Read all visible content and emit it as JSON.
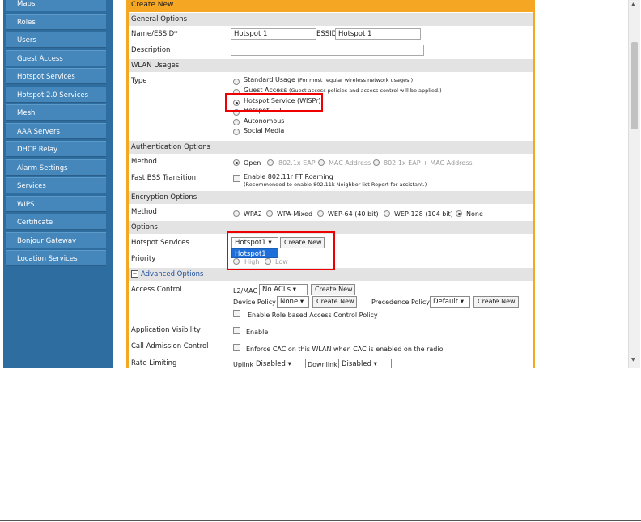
{
  "sidebar": {
    "items": [
      {
        "label": "Maps"
      },
      {
        "label": "Roles"
      },
      {
        "label": "Users"
      },
      {
        "label": "Guest Access"
      },
      {
        "label": "Hotspot Services"
      },
      {
        "label": "Hotspot 2.0 Services"
      },
      {
        "label": "Mesh"
      },
      {
        "label": "AAA Servers"
      },
      {
        "label": "DHCP Relay"
      },
      {
        "label": "Alarm Settings"
      },
      {
        "label": "Services"
      },
      {
        "label": "WIPS"
      },
      {
        "label": "Certificate"
      },
      {
        "label": "Bonjour Gateway"
      },
      {
        "label": "Location Services"
      }
    ]
  },
  "form": {
    "title": "Create New",
    "sections": {
      "general": "General Options",
      "wlan": "WLAN Usages",
      "auth": "Authentication Options",
      "encryption": "Encryption Options",
      "options": "Options",
      "advanced": "Advanced Options"
    },
    "name_label": "Name/ESSID*",
    "name_value": "Hotspot 1",
    "essid_label": "ESSID",
    "essid_value": "Hotspot 1",
    "description_label": "Description",
    "description_value": "",
    "type_label": "Type",
    "type_options": [
      {
        "label": "Standard Usage",
        "note": "(For most regular wireless network usages.)"
      },
      {
        "label": "Guest Access",
        "note": "(Guest access policies and access control will be applied.)"
      },
      {
        "label": "Hotspot Service (WISPr)",
        "note": ""
      },
      {
        "label": "Hotspot 2.0",
        "note": ""
      },
      {
        "label": "Autonomous",
        "note": ""
      },
      {
        "label": "Social Media",
        "note": ""
      }
    ],
    "auth_method_label": "Method",
    "auth_methods": [
      "Open",
      "802.1x EAP",
      "MAC Address",
      "802.1x EAP + MAC Address"
    ],
    "fast_bss_label": "Fast BSS Transition",
    "fast_bss_text": "Enable 802.11r FT Roaming",
    "fast_bss_note": "(Recommended to enable 802.11k Neighbor-list Report for assistant.)",
    "enc_method_label": "Method",
    "enc_methods": [
      "WPA2",
      "WPA-Mixed",
      "WEP-64 (40 bit)",
      "WEP-128 (104 bit)",
      "None"
    ],
    "hotspot_services_label": "Hotspot Services",
    "hotspot_select_value": "Hotspot1",
    "hotspot_dropdown_option": "Hotspot1",
    "create_new_label": "Create New",
    "priority_label": "Priority",
    "priority_options": [
      "High",
      "Low"
    ],
    "access_control_label": "Access Control",
    "l2mac_label": "L2/MAC",
    "l2mac_value": "No ACLs",
    "device_policy_label": "Device Policy",
    "device_policy_value": "None",
    "precedence_policy_label": "Precedence Policy",
    "precedence_policy_value": "Default",
    "role_based_text": "Enable Role based Access Control Policy",
    "app_visibility_label": "Application Visibility",
    "app_visibility_text": "Enable",
    "cac_label": "Call Admission Control",
    "cac_text": "Enforce CAC on this WLAN when CAC is enabled on the radio",
    "rate_limiting_label": "Rate Limiting",
    "uplink_label": "Uplink",
    "uplink_value": "Disabled",
    "downlink_label": "Downlink",
    "downlink_value": "Disabled"
  }
}
